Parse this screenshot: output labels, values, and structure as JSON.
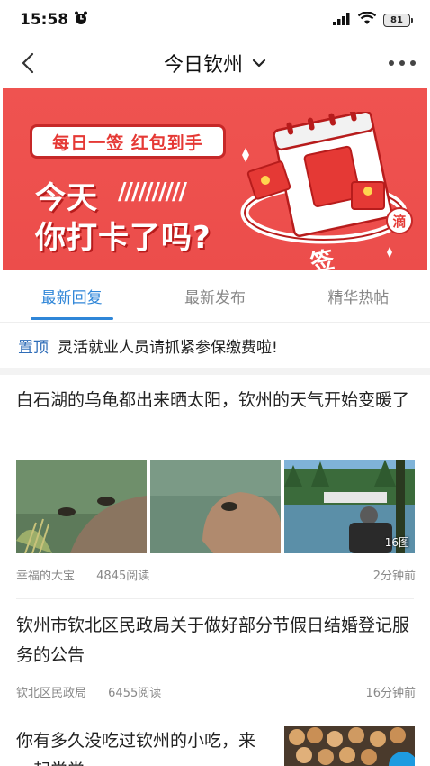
{
  "status_bar": {
    "time": "15:58",
    "battery": "81"
  },
  "nav": {
    "title": "今日钦州"
  },
  "banner": {
    "pill": "每日一签 红包到手",
    "line1": "今天",
    "slashes": "//////////",
    "line2": "你打卡了吗?",
    "badge": "滴",
    "sign_char": "签"
  },
  "tabs": [
    {
      "label": "最新回复",
      "active": true
    },
    {
      "label": "最新发布",
      "active": false
    },
    {
      "label": "精华热帖",
      "active": false
    }
  ],
  "pinned": {
    "tag": "置顶",
    "text": "灵活就业人员请抓紧参保缴费啦!"
  },
  "posts": [
    {
      "title": "白石湖的乌龟都出来晒太阳，钦州的天气开始变暖了",
      "author": "幸福的大宝",
      "views": "4845阅读",
      "time": "2分钟前",
      "image_count": "16图"
    },
    {
      "title": "钦州市钦北区民政局关于做好部分节假日结婚登记服务的公告",
      "author": "钦北区民政局",
      "views": "6455阅读",
      "time": "16分钟前"
    },
    {
      "title": "你有多久没吃过钦州的小吃，来一起尝尝"
    }
  ],
  "colors": {
    "accent": "#2f86d8",
    "banner_red": "#ec4d4b"
  }
}
